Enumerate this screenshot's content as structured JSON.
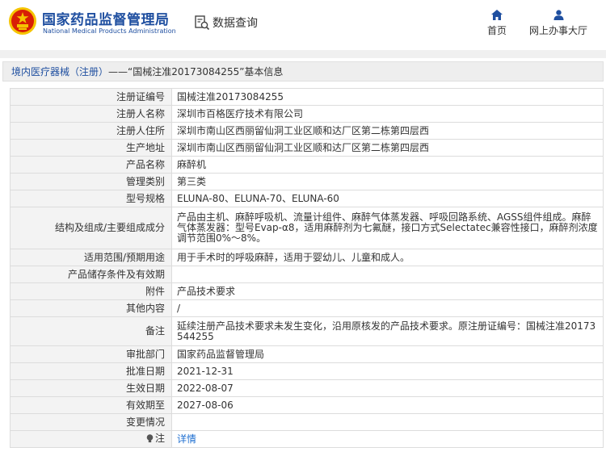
{
  "header": {
    "site_name_cn": "国家药品监督管理局",
    "site_name_en": "National Medical Products Administration",
    "search_label": "数据查询",
    "nav": [
      {
        "label": "首页",
        "icon": "home-icon"
      },
      {
        "label": "网上办事大厅",
        "icon": "person-icon"
      }
    ]
  },
  "breadcrumb": {
    "section": "境内医疗器械（注册）",
    "separator": " —— ",
    "title": "“国械注准20173084255”基本信息"
  },
  "rows": [
    {
      "key": "注册证编号",
      "value": "国械注准20173084255"
    },
    {
      "key": "注册人名称",
      "value": "深圳市百格医疗技术有限公司"
    },
    {
      "key": "注册人住所",
      "value": "深圳市南山区西丽留仙洞工业区顺和达厂区第二栋第四层西"
    },
    {
      "key": "生产地址",
      "value": "深圳市南山区西丽留仙洞工业区顺和达厂区第二栋第四层西"
    },
    {
      "key": "产品名称",
      "value": "麻醉机"
    },
    {
      "key": "管理类别",
      "value": "第三类"
    },
    {
      "key": "型号规格",
      "value": "ELUNA-80、ELUNA-70、ELUNA-60"
    },
    {
      "key": "结构及组成/主要组成成分",
      "value": "产品由主机、麻醉呼吸机、流量计组件、麻醉气体蒸发器、呼吸回路系统、AGSS组件组成。麻醉气体蒸发器：型号Evap-α8，适用麻醉剂为七氟醚，接口方式Selectatec兼容性接口，麻醉剂浓度调节范围0%～8%。"
    },
    {
      "key": "适用范围/预期用途",
      "value": "用于手术时的呼吸麻醉，适用于婴幼儿、儿童和成人。"
    },
    {
      "key": "产品储存条件及有效期",
      "value": ""
    },
    {
      "key": "附件",
      "value": "产品技术要求"
    },
    {
      "key": "其他内容",
      "value": "/"
    },
    {
      "key": "备注",
      "value": "延续注册产品技术要求未发生变化，沿用原核发的产品技术要求。原注册证编号：国械注准20173544255"
    },
    {
      "key": "审批部门",
      "value": "国家药品监督管理局"
    },
    {
      "key": "批准日期",
      "value": "2021-12-31"
    },
    {
      "key": "生效日期",
      "value": "2022-08-07"
    },
    {
      "key": "有效期至",
      "value": "2027-08-06"
    },
    {
      "key": "变更情况",
      "value": ""
    },
    {
      "key": "注",
      "value": "详情",
      "icon": "info-bulb-icon"
    }
  ],
  "colors": {
    "brand_blue": "#1f4fa0",
    "link_blue": "#1f6fd0",
    "emblem_red": "#d81e06",
    "emblem_gold": "#f5c400"
  }
}
